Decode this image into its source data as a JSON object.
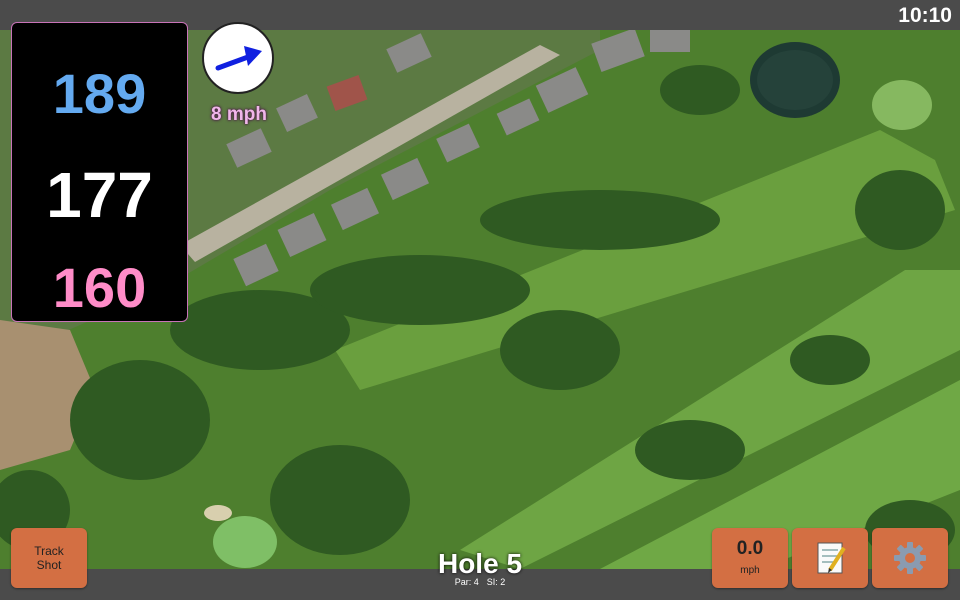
{
  "status_bar": {
    "time": "10:10"
  },
  "yardages": {
    "back": "189",
    "middle": "177",
    "front": "160"
  },
  "wind": {
    "speed": "8 mph",
    "direction_icon": "arrow-right-up-icon"
  },
  "hole": {
    "title": "Hole 5",
    "par": "Par: 4",
    "si": "SI: 2"
  },
  "buttons": {
    "track_shot": "Track\nShot",
    "speed_value": "0.0",
    "speed_unit": "mph",
    "notes_icon": "notepad-icon",
    "settings_icon": "gear-icon"
  },
  "colors": {
    "back_yardage": "#64aaf0",
    "middle_yardage": "#ffffff",
    "front_yardage": "#ff8cc8",
    "button": "#d36f43",
    "wind_arrow": "#1020e0"
  }
}
